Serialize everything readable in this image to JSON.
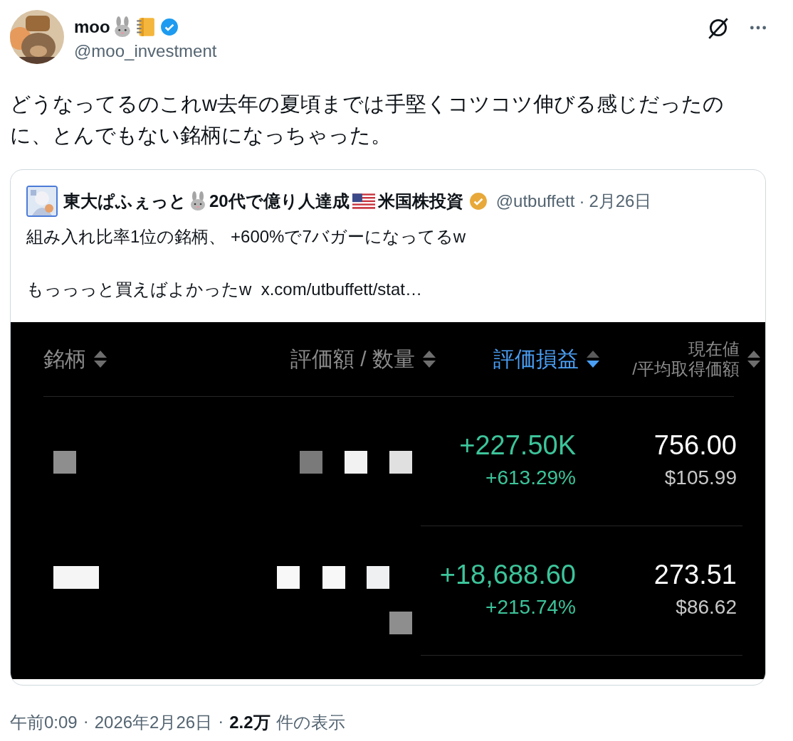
{
  "author": {
    "name": "moo",
    "handle": "@moo_investment",
    "verified": true
  },
  "text": "どうなってるのこれw去年の夏頃までは手堅くコツコツ伸びる感じだったのに、とんでもない銘柄になっちゃった。",
  "quote": {
    "name_parts": [
      "東大ぱふぇっと",
      "20代で億り人達成",
      "米国株投資"
    ],
    "verified": true,
    "handle": "@utbuffett",
    "separator": "·",
    "date": "2月26日",
    "lines": [
      "組み入れ比率1位の銘柄、 +600%で7バガーになってるw",
      "もっっっと買えばよかったw"
    ],
    "link": "x.com/utbuffett/stat…",
    "image": {
      "columns": [
        {
          "label": "銘柄",
          "selected": false
        },
        {
          "label": "評価額 / 数量",
          "selected": false
        },
        {
          "label": "評価損益",
          "selected": true
        },
        {
          "label": "現在値",
          "sublabel": "/平均取得価額",
          "selected": false
        }
      ],
      "rows": [
        {
          "pl": "+227.50K",
          "pct": "+613.29%",
          "price": "756.00",
          "avg": "$105.99"
        },
        {
          "pl": "+18,688.60",
          "pct": "+215.74%",
          "price": "273.51",
          "avg": "$86.62"
        }
      ]
    }
  },
  "meta": {
    "time": "午前0:09",
    "sep1": "·",
    "date": "2026年2月26日",
    "sep2": "·",
    "views": "2.2万",
    "views_label": "件の表示"
  }
}
